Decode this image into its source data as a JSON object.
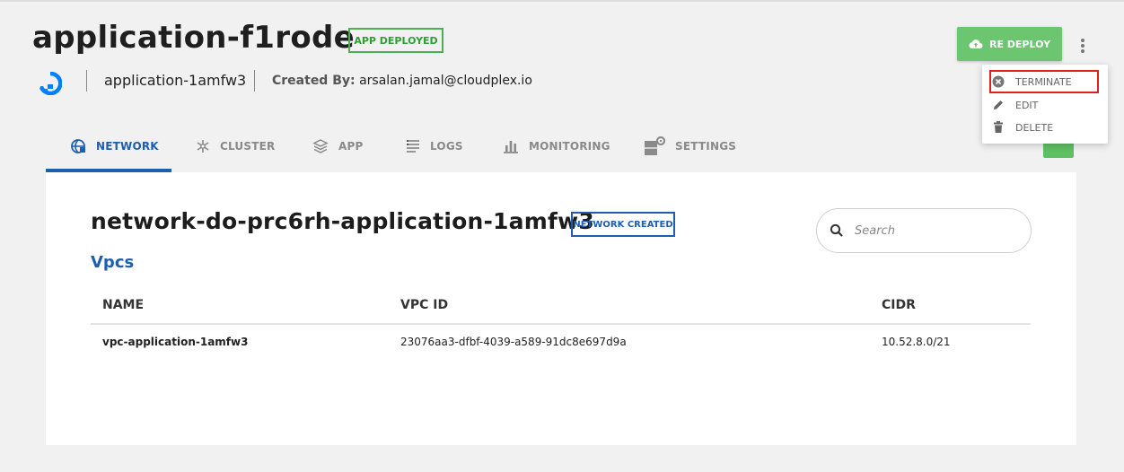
{
  "header": {
    "app_name": "application-f1rode",
    "deploy_status": "APP DEPLOYED",
    "app_subname": "application-1amfw3",
    "created_by_label": "Created By:",
    "created_by_value": "arsalan.jamal@cloudplex.io",
    "provider_icon": "digitalocean-logo-icon"
  },
  "actions": {
    "redeploy_label": "RE DEPLOY",
    "menu": [
      {
        "label": "TERMINATE",
        "icon": "close-circle-icon",
        "highlighted": true
      },
      {
        "label": "EDIT",
        "icon": "pencil-icon"
      },
      {
        "label": "DELETE",
        "icon": "trash-icon"
      }
    ]
  },
  "tabs": [
    {
      "label": "NETWORK",
      "icon": "network-icon",
      "active": true
    },
    {
      "label": "CLUSTER",
      "icon": "cluster-icon"
    },
    {
      "label": "APP",
      "icon": "app-icon"
    },
    {
      "label": "LOGS",
      "icon": "logs-icon"
    },
    {
      "label": "MONITORING",
      "icon": "monitoring-icon"
    },
    {
      "label": "SETTINGS",
      "icon": "settings-icon"
    }
  ],
  "network": {
    "title": "network-do-prc6rh-application-1amfw3",
    "status": "NETWORK CREATED",
    "section_title": "Vpcs",
    "search_placeholder": "Search",
    "columns": [
      "NAME",
      "VPC ID",
      "CIDR"
    ],
    "rows": [
      [
        "vpc-application-1amfw3",
        "23076aa3-dfbf-4039-a589-91dc8e697d9a",
        "10.52.8.0/21"
      ]
    ]
  },
  "colors": {
    "accent": "#1e5eb0",
    "success": "#4caf50",
    "redeploy_bg": "#6cc56f",
    "highlight_border": "#e02020"
  }
}
